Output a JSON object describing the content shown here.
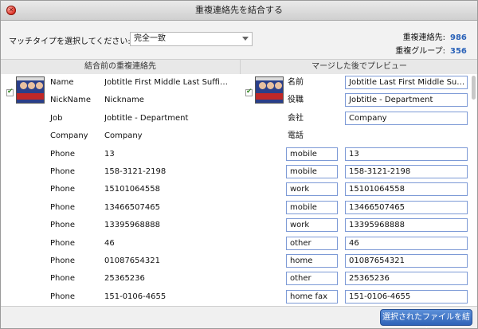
{
  "window": {
    "title": "重複連絡先を結合する"
  },
  "toolbar": {
    "match_label": "マッチタイプを選択してください:",
    "match_value": "完全一致",
    "dup_contacts_label": "重複連絡先:",
    "dup_contacts_count": "986",
    "dup_groups_label": "重複グループ:",
    "dup_groups_count": "356"
  },
  "columns": {
    "left": "結合前の重複連絡先",
    "right": "マージした後でプレビュー"
  },
  "left_rows": [
    {
      "label": "Name",
      "value": "Jobtitle First Middle Last Suffix Job..."
    },
    {
      "label": "NickName",
      "value": "Nickname"
    },
    {
      "label": "Job",
      "value": "Jobtitle - Department"
    },
    {
      "label": "Company",
      "value": "Company"
    },
    {
      "label": "Phone",
      "value": "13"
    },
    {
      "label": "Phone",
      "value": "158-3121-2198"
    },
    {
      "label": "Phone",
      "value": "15101064558"
    },
    {
      "label": "Phone",
      "value": "13466507465"
    },
    {
      "label": "Phone",
      "value": "13395968888"
    },
    {
      "label": "Phone",
      "value": "46"
    },
    {
      "label": "Phone",
      "value": "01087654321"
    },
    {
      "label": "Phone",
      "value": "25365236"
    },
    {
      "label": "Phone",
      "value": "151-0106-4655"
    }
  ],
  "right_rows": [
    {
      "label": "名前",
      "value": "Jobtitle Last First Middle Suffix N..."
    },
    {
      "label": "役職",
      "value": "Jobtitle - Department"
    },
    {
      "label": "会社",
      "value": "Company"
    },
    {
      "label": "電話"
    }
  ],
  "phones": [
    {
      "type": "mobile",
      "value": "13"
    },
    {
      "type": "mobile",
      "value": "158-3121-2198"
    },
    {
      "type": "work",
      "value": "15101064558"
    },
    {
      "type": "mobile",
      "value": "13466507465"
    },
    {
      "type": "work",
      "value": "13395968888"
    },
    {
      "type": "other",
      "value": "46"
    },
    {
      "type": "home",
      "value": "01087654321"
    },
    {
      "type": "other",
      "value": "25365236"
    },
    {
      "type": "home fax",
      "value": "151-0106-4655"
    }
  ],
  "footer": {
    "merge_button": "選択されたファイルを結合"
  },
  "colors": {
    "accent": "#2a62b8",
    "field_border": "#7d9ad6",
    "button": "#3a6fc4"
  }
}
